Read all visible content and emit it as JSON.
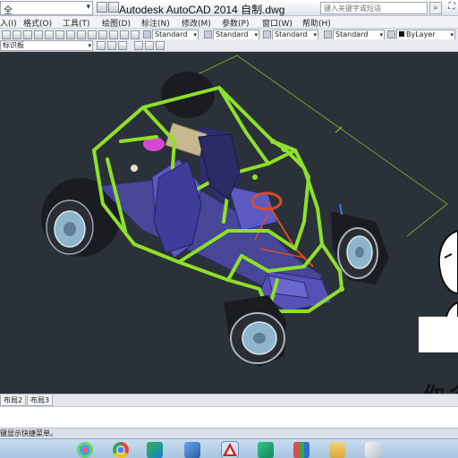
{
  "window": {
    "title": "Autodesk AutoCAD 2014    自制.dwg",
    "workspace_value": "全",
    "search_placeholder": "键入关键字或短语"
  },
  "menubar": {
    "items": [
      "入(I)",
      "格式(O)",
      "工具(T)",
      "绘图(D)",
      "标注(N)",
      "修改(M)",
      "参数(P)",
      "窗口(W)",
      "帮助(H)"
    ]
  },
  "toolbar_styles": {
    "text_style": "Standard",
    "dim_style": "Standard",
    "table_style": "Standard",
    "mleader_style": "Standard"
  },
  "toolbar_props": {
    "layer_value": "标识板",
    "color_value": "ByLayer"
  },
  "overlay": {
    "text": "你彳"
  },
  "layout_tabs": [
    "布局2",
    "布局3"
  ],
  "status": {
    "prompt": "键显示快捷菜单。"
  },
  "taskbar": {
    "icons": [
      "browser-icon",
      "chrome-icon",
      "media-player-icon",
      "tools-icon",
      "autocad-icon",
      "app-icon",
      "books-icon",
      "folder-icon",
      "app2-icon"
    ]
  },
  "colors": {
    "model_space_bg": "#2b3138",
    "frame_green": "#8ee02a",
    "body_purple": "#4c4aa8",
    "tire_black": "#1b1c20",
    "rim_blue": "#8fb5cc"
  }
}
